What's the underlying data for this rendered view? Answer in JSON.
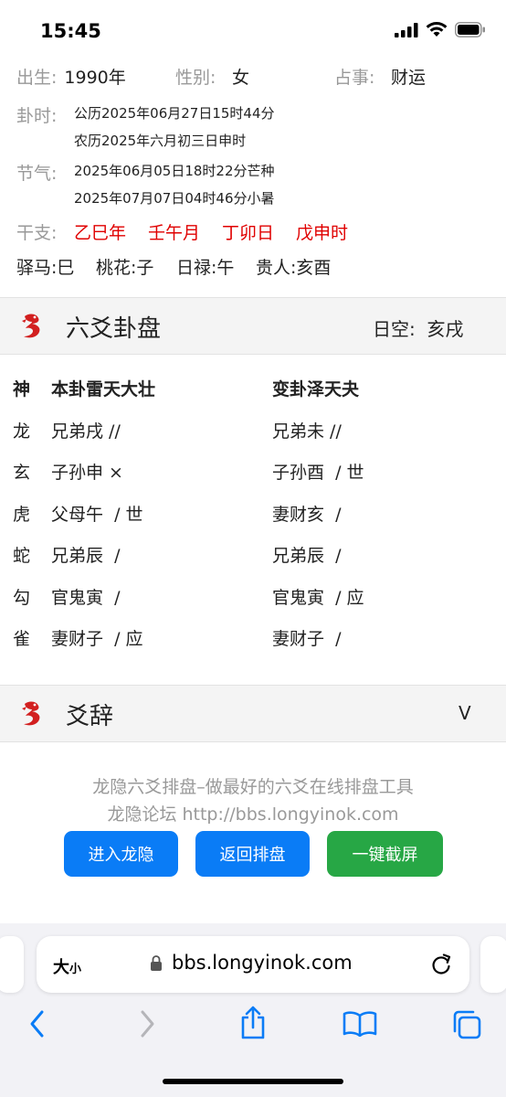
{
  "status": {
    "time": "15:45"
  },
  "info": {
    "birth_label": "出生:",
    "birth_value": "1990年",
    "gender_label": "性别:",
    "gender_value": "女",
    "matter_label": "占事:",
    "matter_value": "财运",
    "time_label": "卦时:",
    "time_solar": "公历2025年06月27日15时44分",
    "time_lunar": "农历2025年六月初三日申时",
    "term_label": "节气:",
    "term_1": "2025年06月05日18时22分芒种",
    "term_2": "2025年07月07日04时46分小暑",
    "ganzhi_label": "干支:",
    "ganzhi": [
      "乙巳年",
      "壬午月",
      "丁卯日",
      "戊申时"
    ],
    "shensha": [
      "驿马:巳",
      "桃花:子",
      "日禄:午",
      "贵人:亥酉"
    ]
  },
  "panel": {
    "title": "六爻卦盘",
    "kong": "日空:  亥戌",
    "head": {
      "shen": "神",
      "ben": "本卦雷天大壮",
      "bian": "变卦泽天夬"
    },
    "rows": [
      {
        "shen": "龙",
        "ben": "兄弟戌 //",
        "bian": "兄弟未 //"
      },
      {
        "shen": "玄",
        "ben": "子孙申 ×",
        "bian": "子孙酉  / 世"
      },
      {
        "shen": "虎",
        "ben": "父母午  / 世",
        "bian": "妻财亥  /"
      },
      {
        "shen": "蛇",
        "ben": "兄弟辰  /",
        "bian": "兄弟辰  /"
      },
      {
        "shen": "勾",
        "ben": "官鬼寅  /",
        "bian": "官鬼寅  / 应"
      },
      {
        "shen": "雀",
        "ben": "妻财子  / 应",
        "bian": "妻财子  /"
      }
    ]
  },
  "yaoci": {
    "title": "爻辞",
    "toggle": "V"
  },
  "footer": {
    "line1": "龙隐六爻排盘–做最好的六爻在线排盘工具",
    "line2": "龙隐论坛 http://bbs.longyinok.com",
    "btn_enter": "进入龙隐",
    "btn_back": "返回排盘",
    "btn_shot": "一键截屏"
  },
  "colors": {
    "blue": "#0a7cf6",
    "green": "#27a745",
    "red": "#e00000"
  },
  "browser": {
    "text_size": "大",
    "text_size_small": "小",
    "url": "bbs.longyinok.com"
  }
}
